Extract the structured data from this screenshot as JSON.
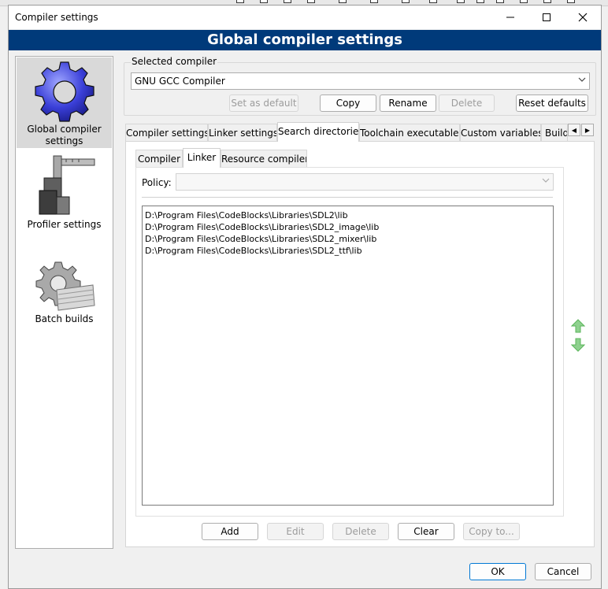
{
  "window": {
    "title": "Compiler settings",
    "minimize_icon": "minimize-icon",
    "maximize_icon": "maximize-icon",
    "close_icon": "close-icon"
  },
  "banner": {
    "title": "Global compiler settings"
  },
  "sidebar": {
    "items": [
      {
        "label_line1": "Global compiler",
        "label_line2": "settings",
        "icon": "gear-icon",
        "selected": true
      },
      {
        "label_line1": "Profiler settings",
        "label_line2": "",
        "icon": "caliper-icon",
        "selected": false
      },
      {
        "label_line1": "Batch builds",
        "label_line2": "",
        "icon": "gear-stack-icon",
        "selected": false
      }
    ]
  },
  "compiler": {
    "group_label": "Selected compiler",
    "selected_value": "GNU GCC Compiler",
    "buttons": {
      "set_as_default": "Set as default",
      "copy": "Copy",
      "rename": "Rename",
      "delete": "Delete",
      "reset_defaults": "Reset defaults"
    }
  },
  "main_tabs": [
    {
      "label": "Compiler settings",
      "active": false
    },
    {
      "label": "Linker settings",
      "active": false
    },
    {
      "label": "Search directories",
      "active": true
    },
    {
      "label": "Toolchain executables",
      "active": false
    },
    {
      "label": "Custom variables",
      "active": false
    },
    {
      "label": "Build",
      "active": false
    }
  ],
  "sub_tabs": [
    {
      "label": "Compiler",
      "active": false
    },
    {
      "label": "Linker",
      "active": true
    },
    {
      "label": "Resource compiler",
      "active": false
    }
  ],
  "policy": {
    "label": "Policy:",
    "value": ""
  },
  "directories": [
    "D:\\Program Files\\CodeBlocks\\Libraries\\SDL2\\lib",
    "D:\\Program Files\\CodeBlocks\\Libraries\\SDL2_image\\lib",
    "D:\\Program Files\\CodeBlocks\\Libraries\\SDL2_mixer\\lib",
    "D:\\Program Files\\CodeBlocks\\Libraries\\SDL2_ttf\\lib"
  ],
  "list_buttons": {
    "add": "Add",
    "edit": "Edit",
    "delete": "Delete",
    "clear": "Clear",
    "copy_to": "Copy to..."
  },
  "dialog_buttons": {
    "ok": "OK",
    "cancel": "Cancel"
  },
  "colors": {
    "banner": "#003a7a",
    "accent": "#0078d4",
    "arrow_green": "#5bb55b"
  }
}
